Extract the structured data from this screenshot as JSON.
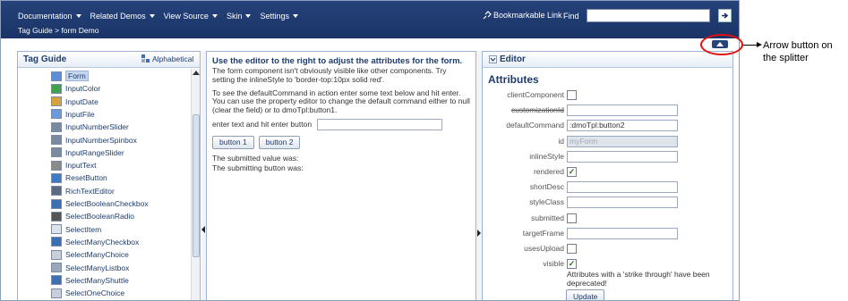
{
  "topbar": {
    "menus": [
      "Documentation",
      "Related Demos",
      "View Source",
      "Skin",
      "Settings"
    ],
    "breadcrumb": "Tag Guide > form Demo",
    "bookmark": "Bookmarkable Link",
    "find_label": "Find",
    "find_value": ""
  },
  "left": {
    "title": "Tag Guide",
    "sort_label": "Alphabetical",
    "items": [
      "Form",
      "InputColor",
      "InputDate",
      "InputFile",
      "InputNumberSlider",
      "InputNumberSpinbox",
      "InputRangeSlider",
      "InputText",
      "ResetButton",
      "RichTextEditor",
      "SelectBooleanCheckbox",
      "SelectBooleanRadio",
      "SelectItem",
      "SelectManyCheckbox",
      "SelectManyChoice",
      "SelectManyListbox",
      "SelectManyShuttle",
      "SelectOneChoice"
    ],
    "selected_index": 0
  },
  "center": {
    "title": "Use the editor to the right to adjust the attributes for the form.",
    "desc1": "The form component isn't obviously visible like other components. Try setting the inlineStyle to 'border-top:10px solid red'.",
    "desc2": "To see the defaultCommand in action enter some text below and hit enter. You can use the property editor to change the default command either to null (clear the field) or to dmoTpl:button1.",
    "input_label": "enter text and hit enter button",
    "input_value": "",
    "button1": "button 1",
    "button2": "button 2",
    "submitted_value": "The submitted value was:",
    "submitting_button": "The submitting button was:"
  },
  "editor": {
    "title": "Editor",
    "section": "Attributes",
    "attrs": [
      {
        "label": "clientComponent",
        "type": "check",
        "checked": false
      },
      {
        "label": "customizationId",
        "type": "text",
        "value": "",
        "strike": true
      },
      {
        "label": "defaultCommand",
        "type": "text",
        "value": ":dmoTpl:button2"
      },
      {
        "label": "id",
        "type": "text",
        "value": "myForm",
        "readonly": true
      },
      {
        "label": "inlineStyle",
        "type": "text",
        "value": ""
      },
      {
        "label": "rendered",
        "type": "check",
        "checked": true
      },
      {
        "label": "shortDesc",
        "type": "text",
        "value": ""
      },
      {
        "label": "styleClass",
        "type": "text",
        "value": ""
      },
      {
        "label": "submitted",
        "type": "check",
        "checked": false
      },
      {
        "label": "targetFrame",
        "type": "text",
        "value": ""
      },
      {
        "label": "usesUpload",
        "type": "check",
        "checked": false
      },
      {
        "label": "visible",
        "type": "check",
        "checked": true
      }
    ],
    "note": "Attributes with a 'strike through' have been deprecated!",
    "update": "Update"
  },
  "annotation": {
    "text": "Arrow button on the splitter",
    "color": "#e01010"
  }
}
